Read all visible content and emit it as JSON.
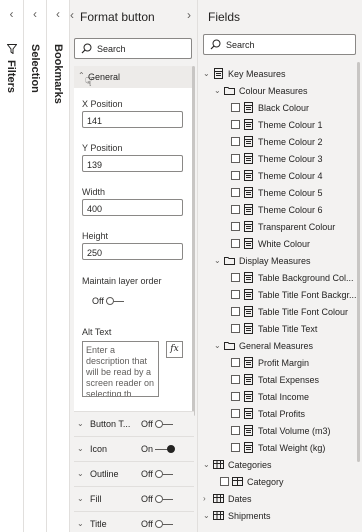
{
  "filters": {
    "label": "Filters",
    "chevron": "‹"
  },
  "selection": {
    "label": "Selection",
    "chevron": "‹"
  },
  "bookmarks": {
    "label": "Bookmarks",
    "chevron": "‹"
  },
  "format_pane": {
    "back": "‹",
    "title": "Format button",
    "forward": "›",
    "search_placeholder": "Search",
    "general": {
      "label": "General",
      "x_position_label": "X Position",
      "x_position": "141",
      "y_position_label": "Y Position",
      "y_position": "139",
      "width_label": "Width",
      "width": "400",
      "height_label": "Height",
      "height": "250",
      "maintain_layer_label": "Maintain layer order",
      "maintain_layer_state": "Off",
      "alt_text_label": "Alt Text",
      "alt_text_placeholder": "Enter a description that will be read by a screen reader on selecting th...",
      "fx": "fx"
    },
    "sections": [
      {
        "label": "Button T...",
        "state": "Off"
      },
      {
        "label": "Icon",
        "state": "On"
      },
      {
        "label": "Outline",
        "state": "Off"
      },
      {
        "label": "Fill",
        "state": "Off"
      },
      {
        "label": "Title",
        "state": "Off"
      }
    ]
  },
  "fields_pane": {
    "title": "Fields",
    "search_placeholder": "Search",
    "tree": [
      {
        "type": "table",
        "label": "Key Measures",
        "level": 0,
        "expanded": true,
        "icon": "measure-table-icon"
      },
      {
        "type": "folder",
        "label": "Colour Measures",
        "level": 1,
        "expanded": true,
        "icon": "folder-icon"
      },
      {
        "type": "measure",
        "label": "Black Colour",
        "level": 2,
        "icon": "measure-icon"
      },
      {
        "type": "measure",
        "label": "Theme Colour 1",
        "level": 2,
        "icon": "measure-icon"
      },
      {
        "type": "measure",
        "label": "Theme Colour 2",
        "level": 2,
        "icon": "measure-icon"
      },
      {
        "type": "measure",
        "label": "Theme Colour 3",
        "level": 2,
        "icon": "measure-icon"
      },
      {
        "type": "measure",
        "label": "Theme Colour 4",
        "level": 2,
        "icon": "measure-icon"
      },
      {
        "type": "measure",
        "label": "Theme Colour 5",
        "level": 2,
        "icon": "measure-icon"
      },
      {
        "type": "measure",
        "label": "Theme Colour 6",
        "level": 2,
        "icon": "measure-icon"
      },
      {
        "type": "measure",
        "label": "Transparent Colour",
        "level": 2,
        "icon": "measure-icon"
      },
      {
        "type": "measure",
        "label": "White Colour",
        "level": 2,
        "icon": "measure-icon"
      },
      {
        "type": "folder",
        "label": "Display Measures",
        "level": 1,
        "expanded": true,
        "icon": "folder-icon"
      },
      {
        "type": "measure",
        "label": "Table Background Col...",
        "level": 2,
        "icon": "measure-icon"
      },
      {
        "type": "measure",
        "label": "Table Title Font Backgr...",
        "level": 2,
        "icon": "measure-icon"
      },
      {
        "type": "measure",
        "label": "Table Title Font Colour",
        "level": 2,
        "icon": "measure-icon"
      },
      {
        "type": "measure",
        "label": "Table Title Text",
        "level": 2,
        "icon": "measure-icon"
      },
      {
        "type": "folder",
        "label": "General Measures",
        "level": 1,
        "expanded": true,
        "icon": "folder-icon"
      },
      {
        "type": "measure",
        "label": "Profit Margin",
        "level": 2,
        "icon": "measure-icon"
      },
      {
        "type": "measure",
        "label": "Total Expenses",
        "level": 2,
        "icon": "measure-icon"
      },
      {
        "type": "measure",
        "label": "Total Income",
        "level": 2,
        "icon": "measure-icon"
      },
      {
        "type": "measure",
        "label": "Total Profits",
        "level": 2,
        "icon": "measure-icon"
      },
      {
        "type": "measure",
        "label": "Total Volume (m3)",
        "level": 2,
        "icon": "measure-icon"
      },
      {
        "type": "measure",
        "label": "Total Weight (kg)",
        "level": 2,
        "icon": "measure-icon"
      },
      {
        "type": "table",
        "label": "Categories",
        "level": 0,
        "expanded": true,
        "icon": "table-icon"
      },
      {
        "type": "column",
        "label": "Category",
        "level": 1,
        "icon": "column-icon"
      },
      {
        "type": "table",
        "label": "Dates",
        "level": 0,
        "expanded": false,
        "icon": "table-icon"
      },
      {
        "type": "table",
        "label": "Shipments",
        "level": 0,
        "expanded": true,
        "icon": "table-icon"
      }
    ]
  },
  "colors": {
    "pane_bg": "#f3f2f1",
    "border": "#e1dfdd",
    "text": "#252423",
    "input_border": "#8a8886"
  }
}
